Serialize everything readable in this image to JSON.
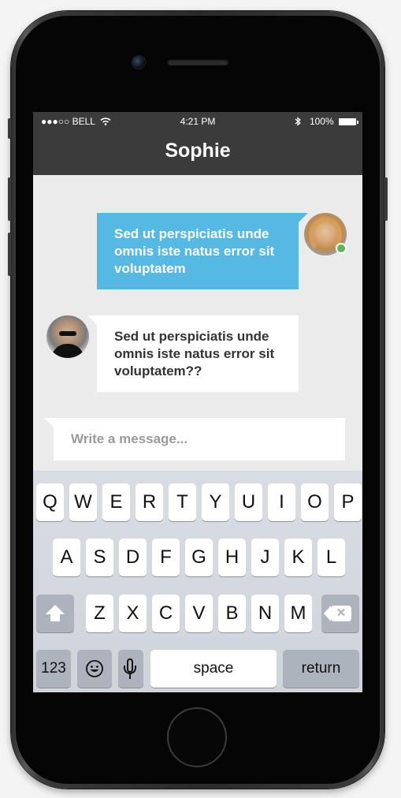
{
  "status_bar": {
    "carrier": "●●●○○ BELL",
    "time": "4:21 PM",
    "battery": "100%"
  },
  "header": {
    "title": "Sophie"
  },
  "messages": [
    {
      "direction": "outgoing",
      "text": "Sed ut perspiciatis unde omnis iste natus error sit voluptatem",
      "status": "online"
    },
    {
      "direction": "incoming",
      "text": "Sed ut perspiciatis unde omnis iste natus error sit voluptatem??"
    }
  ],
  "composer": {
    "placeholder": "Write a message..."
  },
  "keyboard": {
    "row1": [
      "Q",
      "W",
      "E",
      "R",
      "T",
      "Y",
      "U",
      "I",
      "O",
      "P"
    ],
    "row2": [
      "A",
      "S",
      "D",
      "F",
      "G",
      "H",
      "J",
      "K",
      "L"
    ],
    "row3": [
      "Z",
      "X",
      "C",
      "V",
      "B",
      "N",
      "M"
    ],
    "numbers_label": "123",
    "space_label": "space",
    "return_label": "return"
  },
  "colors": {
    "accent_bubble": "#55b9e4",
    "header_bg": "#3b3b3b",
    "online": "#5cb85c"
  }
}
